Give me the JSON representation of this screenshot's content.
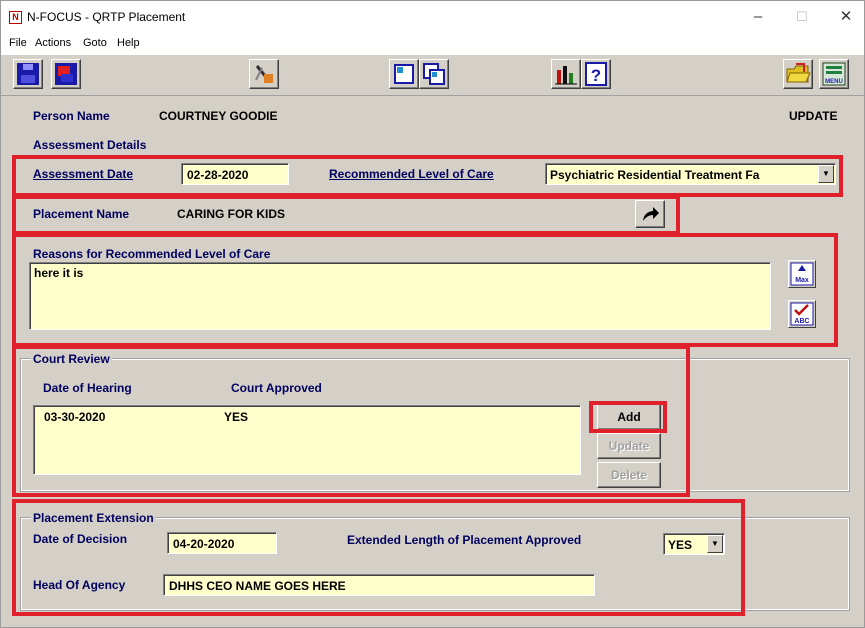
{
  "window": {
    "title": "N-FOCUS - QRTP Placement",
    "logo_letter": "N"
  },
  "window_controls": {
    "minimize": "–",
    "maximize": "☐",
    "close": "✕"
  },
  "menu": [
    "File",
    "Actions",
    "Goto",
    "Help"
  ],
  "toolbar": {
    "icons": [
      "save-icon",
      "exit-icon",
      "tools-icon",
      "window-icon",
      "multi-window-icon",
      "chart-icon",
      "help-icon",
      "open-folder-icon",
      "menu-icon"
    ],
    "menu_icon_text": "MENU"
  },
  "header": {
    "person_name_label": "Person Name",
    "person_name": "COURTNEY GOODIE",
    "mode": "UPDATE"
  },
  "assessment": {
    "section_title": "Assessment Details",
    "date_label": "Assessment Date",
    "date_value": "02-28-2020",
    "level_label": "Recommended Level of Care",
    "level_value": "Psychiatric Residential Treatment Fa"
  },
  "placement": {
    "label": "Placement Name",
    "value": "CARING FOR KIDS"
  },
  "reasons": {
    "label": "Reasons for Recommended Level of Care",
    "value": "here it is",
    "max_icon_text": "Max",
    "spell_icon_text": "ABC"
  },
  "court_review": {
    "section_title": "Court Review",
    "columns": [
      "Date of Hearing",
      "Court Approved"
    ],
    "rows": [
      {
        "date": "03-30-2020",
        "approved": "YES"
      }
    ],
    "buttons": {
      "add": "Add",
      "update": "Update",
      "delete": "Delete"
    }
  },
  "extension": {
    "section_title": "Placement Extension",
    "decision_label": "Date of Decision",
    "decision_value": "04-20-2020",
    "approved_label": "Extended Length of Placement Approved",
    "approved_value": "YES",
    "head_label": "Head Of Agency",
    "head_value": "DHHS CEO NAME GOES HERE"
  },
  "colors": {
    "highlight": "#e0202a",
    "field_bg": "#ffffcc",
    "label_color": "#00005e",
    "window_bg": "#d4d0c8"
  }
}
